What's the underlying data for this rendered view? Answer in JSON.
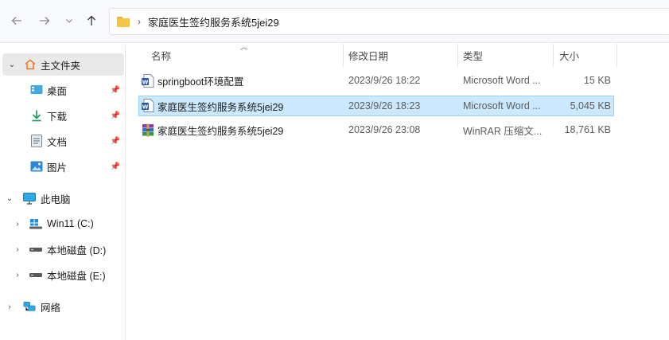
{
  "nav": {
    "back_icon": "arrow-left-icon",
    "forward_icon": "arrow-right-icon",
    "recent_icon": "chevron-down-icon",
    "up_icon": "arrow-up-icon"
  },
  "address": {
    "folder_icon": "folder-icon",
    "separator": "›",
    "path": "家庭医生签约服务系统5jei29"
  },
  "sidebar": {
    "quick_access": {
      "label": "主文件夹",
      "icon": "home-icon",
      "chevron": "⌄"
    },
    "pinned": [
      {
        "label": "桌面",
        "icon": "desktop-icon"
      },
      {
        "label": "下载",
        "icon": "download-icon"
      },
      {
        "label": "文档",
        "icon": "document-icon"
      },
      {
        "label": "图片",
        "icon": "pictures-icon"
      }
    ],
    "this_pc": {
      "label": "此电脑",
      "icon": "monitor-icon",
      "chevron": "⌄"
    },
    "drives": [
      {
        "label": "Win11 (C:)",
        "icon": "windows-drive-icon"
      },
      {
        "label": "本地磁盘 (D:)",
        "icon": "drive-icon"
      },
      {
        "label": "本地磁盘 (E:)",
        "icon": "drive-icon"
      }
    ],
    "network": {
      "label": "网络",
      "icon": "network-icon"
    }
  },
  "columns": {
    "name": "名称",
    "modified": "修改日期",
    "type": "类型",
    "size": "大小"
  },
  "files": [
    {
      "name": "springboot环境配置",
      "modified": "2023/9/26 18:22",
      "type": "Microsoft Word ...",
      "size": "15 KB",
      "icon": "word-doc-icon",
      "selected": false
    },
    {
      "name": "家庭医生签约服务系统5jei29",
      "modified": "2023/9/26 18:23",
      "type": "Microsoft Word ...",
      "size": "5,045 KB",
      "icon": "word-doc-icon",
      "selected": true
    },
    {
      "name": "家庭医生签约服务系统5jei29",
      "modified": "2023/9/26 23:08",
      "type": "WinRAR 压缩文...",
      "size": "18,761 KB",
      "icon": "winrar-archive-icon",
      "selected": false
    }
  ],
  "colors": {
    "selection_bg": "#cce8ff",
    "selection_border": "#99d1ff",
    "folder": "#f6c544",
    "word_blue": "#2b579a"
  }
}
